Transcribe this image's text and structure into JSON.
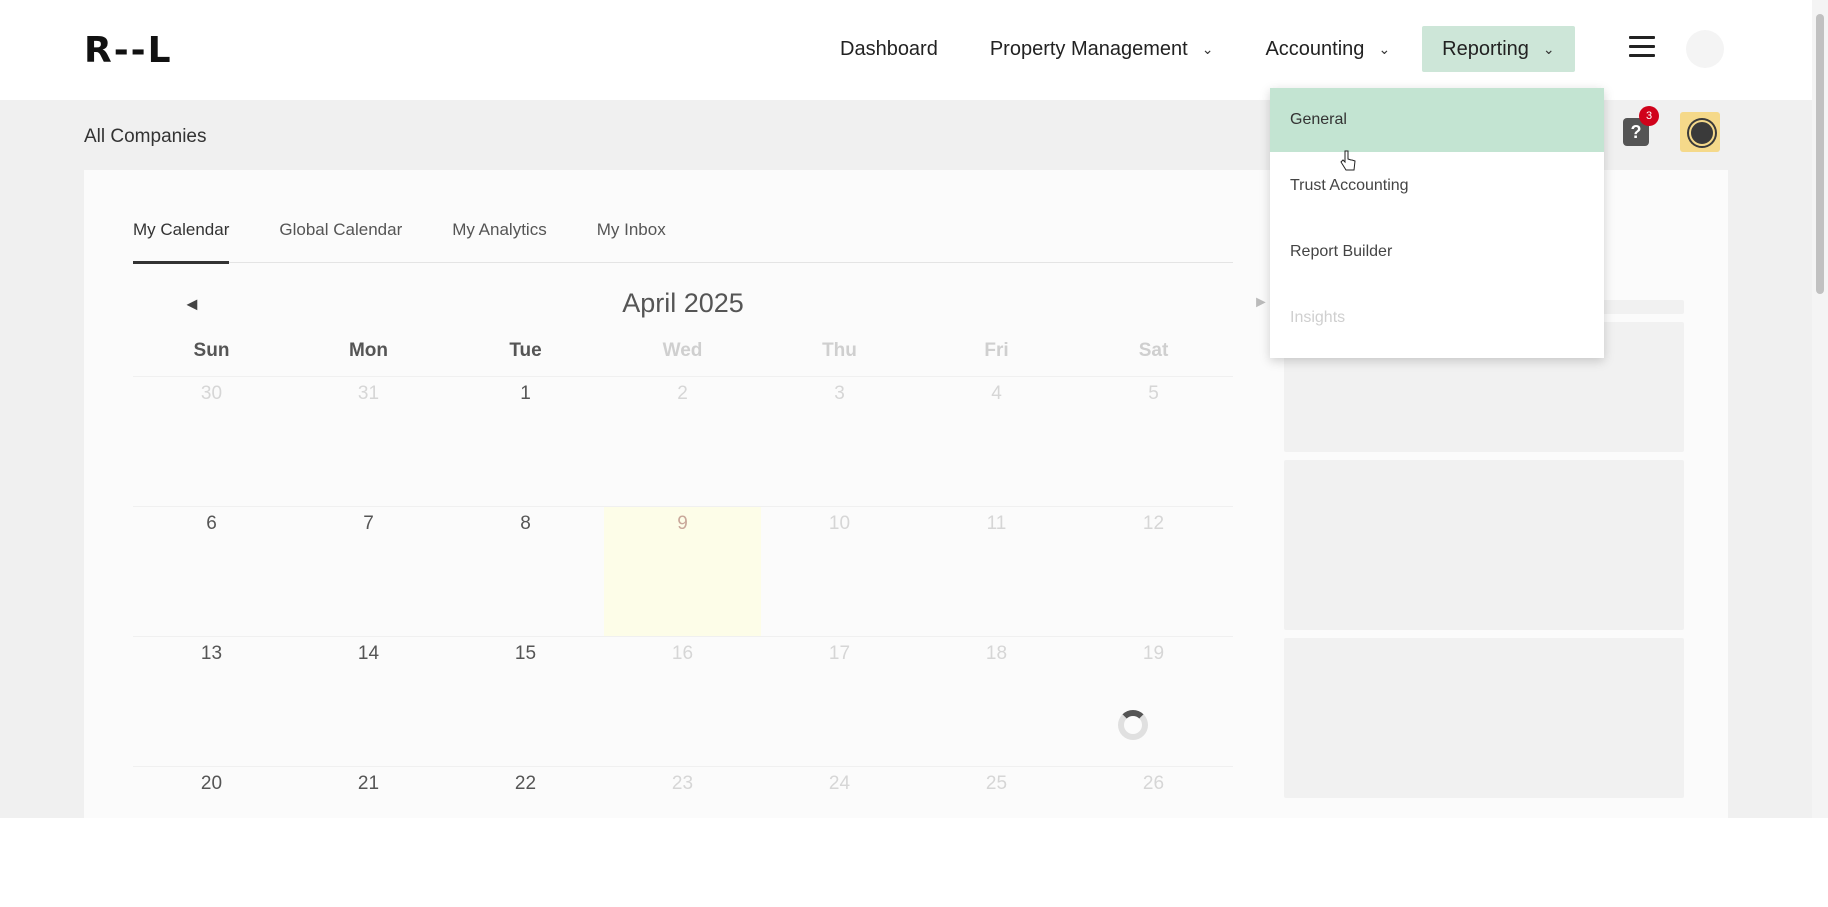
{
  "brand": {
    "logo_text": "R--L"
  },
  "nav": {
    "items": [
      {
        "label": "Dashboard",
        "has_dropdown": false
      },
      {
        "label": "Property Management",
        "has_dropdown": true
      },
      {
        "label": "Accounting",
        "has_dropdown": true
      },
      {
        "label": "Reporting",
        "has_dropdown": true,
        "active": true
      }
    ],
    "chevron": "⌄"
  },
  "company": {
    "label": "All Companies"
  },
  "notifications": {
    "count": "3",
    "help_icon": "?"
  },
  "tabs": [
    {
      "label": "My Calendar",
      "active": true
    },
    {
      "label": "Global Calendar"
    },
    {
      "label": "My Analytics"
    },
    {
      "label": "My Inbox"
    }
  ],
  "calendar": {
    "month_label": "April 2025",
    "prev_icon": "◄",
    "next_icon": "►",
    "days_of_week": [
      "Sun",
      "Mon",
      "Tue",
      "Wed",
      "Thu",
      "Fri",
      "Sat"
    ],
    "weeks": [
      [
        "30",
        "31",
        "1",
        "2",
        "3",
        "4",
        "5"
      ],
      [
        "6",
        "7",
        "8",
        "9",
        "10",
        "11",
        "12"
      ],
      [
        "13",
        "14",
        "15",
        "16",
        "17",
        "18",
        "19"
      ],
      [
        "20",
        "21",
        "22",
        "23",
        "24",
        "25",
        "26"
      ]
    ],
    "today": "9"
  },
  "reporting_menu": {
    "items": [
      {
        "label": "General",
        "active": true
      },
      {
        "label": "Trust Accounting"
      },
      {
        "label": "Report Builder"
      },
      {
        "label": "Insights",
        "faint": true
      }
    ]
  },
  "colors": {
    "active_nav_bg": "#cde6d8",
    "dropdown_active_bg": "#c3e4d2",
    "badge": "#d0021b",
    "today_cell": "#fdfde8"
  }
}
